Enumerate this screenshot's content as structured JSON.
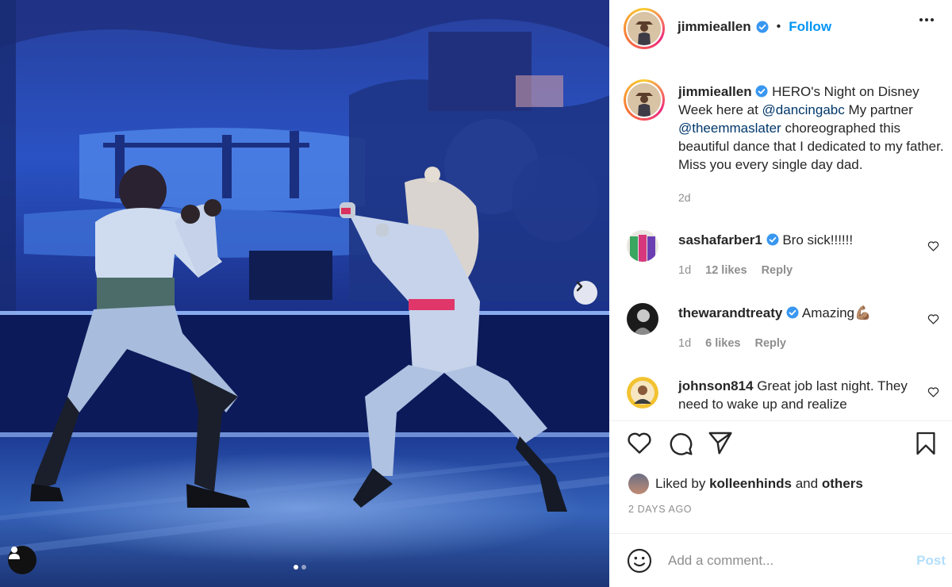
{
  "post": {
    "image_alt": "",
    "carousel": {
      "total": 2,
      "current": 1
    }
  },
  "header": {
    "username": "jimmieallen",
    "separator": "•",
    "follow_label": "Follow",
    "more_icon": "more-horizontal-icon"
  },
  "caption": {
    "username": "jimmieallen",
    "text_1": "HERO's Night on Disney Week here at",
    "mention_1": "@dancingabc",
    "text_2": "My partner",
    "mention_2": "@theemmaslater",
    "text_3": "choreographed this beautiful dance that I dedicated to my father. Miss you every single day dad.",
    "time": "2d"
  },
  "comments": [
    {
      "username": "sashafarber1",
      "verified": true,
      "text": "Bro sick!!!!!!",
      "time": "1d",
      "likes": "12 likes",
      "reply": "Reply"
    },
    {
      "username": "thewarandtreaty",
      "verified": true,
      "text": "Amazing💪🏽",
      "time": "1d",
      "likes": "6 likes",
      "reply": "Reply"
    },
    {
      "username": "johnson814",
      "verified": false,
      "text": "Great job last night. They need to wake up and realize"
    }
  ],
  "liked_by": {
    "prefix": "Liked by",
    "user": "kolleenhinds",
    "and": "and",
    "others": "others"
  },
  "timestamp": "2 DAYS AGO",
  "comment_box": {
    "placeholder": "Add a comment...",
    "post_label": "Post"
  },
  "colors": {
    "accent": "#0095f6",
    "verified": "#3897f0",
    "muted": "#8e8e8e",
    "post_disabled": "#b2dffc"
  }
}
